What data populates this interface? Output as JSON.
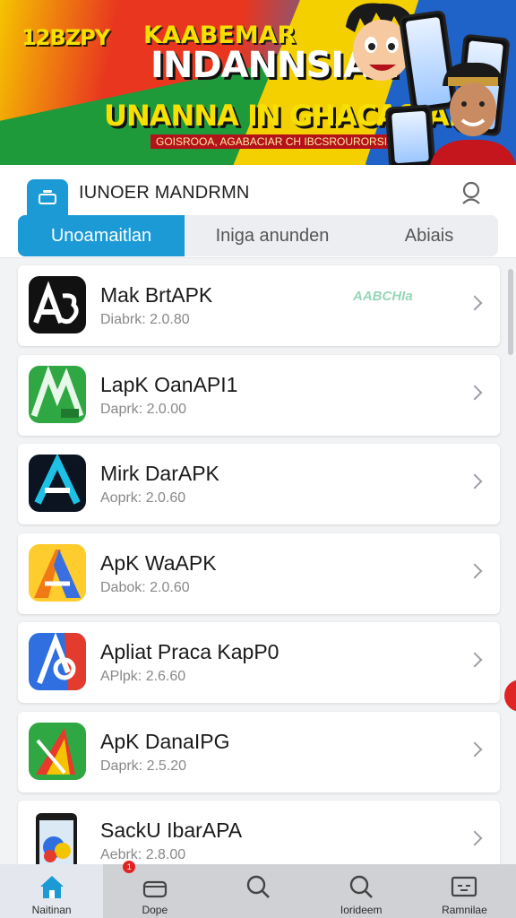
{
  "banner": {
    "promo": "12BZPY",
    "kicker": "KAABEMAR",
    "headline": "INDANNSIAN",
    "subline": "UNANNA IN GHACASIAN!",
    "tagline": "GOISROOA, AGABACIAR CH IBCSROURORSIA"
  },
  "header": {
    "title": "IUNOER MANDRMN",
    "tabs": [
      "Unoamaitlan",
      "Iniga anunden",
      "Abiais"
    ]
  },
  "apps": [
    {
      "name": "Mak BrtAPK",
      "meta": "Diabrk: 2.0.80",
      "badge": "AABCHIa",
      "icon": "a3-icon"
    },
    {
      "name": "LapK OanAPI1",
      "meta": "Daprk: 2.0.00",
      "badge": "",
      "icon": "green-m-icon"
    },
    {
      "name": "Mirk DarAPK",
      "meta": "Aoprk: 2.0.60",
      "badge": "",
      "icon": "blue-a-icon"
    },
    {
      "name": "ApK WaAPK",
      "meta": "Dabok: 2.0.60",
      "badge": "",
      "icon": "orange-a-icon"
    },
    {
      "name": "Apliat Praca KapP0",
      "meta": "APlpk: 2.6.60",
      "badge": "",
      "icon": "blue-red-a-icon"
    },
    {
      "name": "ApK DanaIPG",
      "meta": "Daprk: 2.5.20",
      "badge": "",
      "icon": "colorful-triangle-icon"
    },
    {
      "name": "SackU IbarAPA",
      "meta": "Aebrk: 2.8.00",
      "badge": "",
      "icon": "phone-icon"
    }
  ],
  "nav": [
    {
      "label": "Naitinan",
      "icon": "home-icon"
    },
    {
      "label": "Dope",
      "icon": "basket-icon",
      "badge": "1"
    },
    {
      "label": "",
      "icon": "search-icon"
    },
    {
      "label": "Iorideem",
      "icon": "search-icon"
    },
    {
      "label": "Ramnilae",
      "icon": "card-icon"
    }
  ],
  "colors": {
    "accent": "#1b9ad6",
    "badge": "#e02424"
  }
}
